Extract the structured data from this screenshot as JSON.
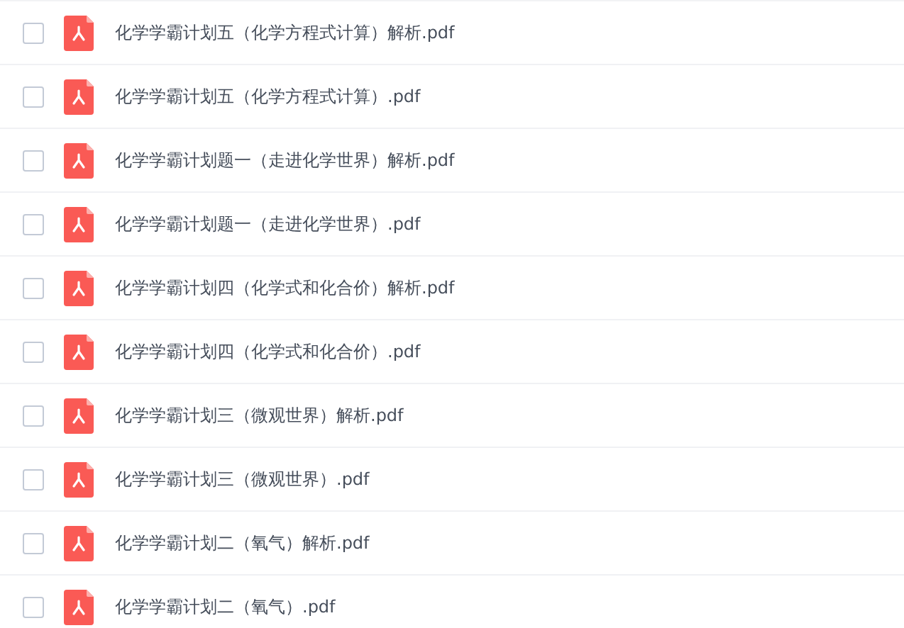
{
  "files": [
    {
      "name": "化学学霸计划五（化学方程式计算）解析.pdf",
      "checked": false
    },
    {
      "name": "化学学霸计划五（化学方程式计算）.pdf",
      "checked": false
    },
    {
      "name": "化学学霸计划题一（走进化学世界）解析.pdf",
      "checked": false
    },
    {
      "name": "化学学霸计划题一（走进化学世界）.pdf",
      "checked": false
    },
    {
      "name": "化学学霸计划四（化学式和化合价）解析.pdf",
      "checked": false
    },
    {
      "name": "化学学霸计划四（化学式和化合价）.pdf",
      "checked": false
    },
    {
      "name": "化学学霸计划三（微观世界）解析.pdf",
      "checked": false
    },
    {
      "name": "化学学霸计划三（微观世界）.pdf",
      "checked": false
    },
    {
      "name": "化学学霸计划二（氧气）解析.pdf",
      "checked": false
    },
    {
      "name": "化学学霸计划二（氧气）.pdf",
      "checked": false
    }
  ]
}
